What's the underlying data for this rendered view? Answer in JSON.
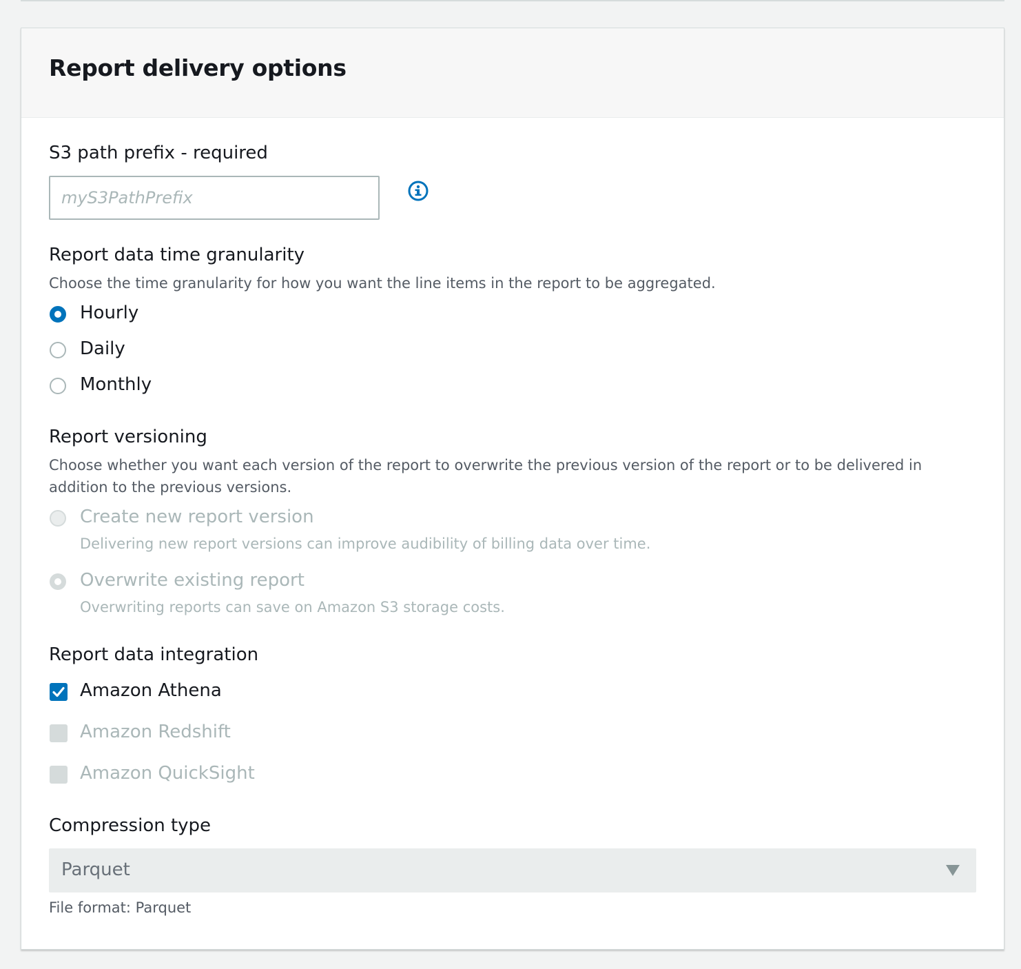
{
  "panel": {
    "title": "Report delivery options"
  },
  "s3_prefix": {
    "label": "S3 path prefix - required",
    "placeholder": "myS3PathPrefix",
    "value": "",
    "info_icon": "info-circle-icon"
  },
  "granularity": {
    "label": "Report data time granularity",
    "description": "Choose the time granularity for how you want the line items in the report to be aggregated.",
    "selected": "Hourly",
    "options": [
      {
        "label": "Hourly",
        "checked": true
      },
      {
        "label": "Daily",
        "checked": false
      },
      {
        "label": "Monthly",
        "checked": false
      }
    ]
  },
  "versioning": {
    "label": "Report versioning",
    "description": "Choose whether you want each version of the report to overwrite the previous version of the report or to be delivered in addition to the previous versions.",
    "options": [
      {
        "label": "Create new report version",
        "description": "Delivering new report versions can improve audibility of billing data over time.",
        "checked": false,
        "disabled": true
      },
      {
        "label": "Overwrite existing report",
        "description": "Overwriting reports can save on Amazon S3 storage costs.",
        "checked": true,
        "disabled": true
      }
    ]
  },
  "integration": {
    "label": "Report data integration",
    "options": [
      {
        "label": "Amazon Athena",
        "checked": true,
        "disabled": false
      },
      {
        "label": "Amazon Redshift",
        "checked": false,
        "disabled": true
      },
      {
        "label": "Amazon QuickSight",
        "checked": false,
        "disabled": true
      }
    ]
  },
  "compression": {
    "label": "Compression type",
    "selected": "Parquet",
    "disabled": true,
    "hint": "File format: Parquet"
  },
  "colors": {
    "accent": "#0073bb",
    "disabled": "#aab7b8",
    "text": "#16191f",
    "secondary_text": "#545b64"
  }
}
